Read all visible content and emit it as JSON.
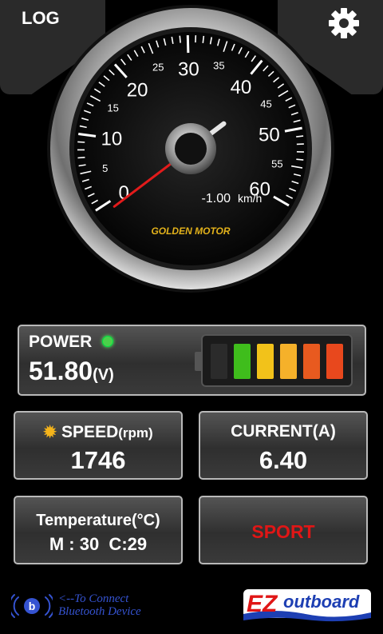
{
  "header": {
    "log_label": "LOG",
    "settings_icon": "gear-icon"
  },
  "gauge": {
    "major_labels": [
      "0",
      "10",
      "20",
      "30",
      "40",
      "50",
      "60"
    ],
    "minor_labels": [
      "5",
      "15",
      "25",
      "35",
      "45",
      "55"
    ],
    "brand": "GOLDEN MOTOR",
    "speed_value": "-1.00",
    "speed_unit": "km/h",
    "needle_value": -1.0,
    "range": [
      0,
      60
    ]
  },
  "power": {
    "label": "POWER",
    "value": "51.80",
    "unit": "(V)",
    "status_color": "#4ad14a",
    "battery_cells": [
      "#2b2b2b",
      "#3fbd1c",
      "#f2c21a",
      "#f5b12a",
      "#e85a1f",
      "#e8481d"
    ]
  },
  "speed": {
    "label": "SPEED",
    "unit": "(rpm)",
    "value": "1746",
    "icon": "sun-icon"
  },
  "current": {
    "label": "CURRENT(A)",
    "value": "6.40"
  },
  "temperature": {
    "label": "Temperature(°C)",
    "value": "M : 30  C:29"
  },
  "mode": {
    "label": "SPORT",
    "color": "#e01616"
  },
  "bluetooth": {
    "icon": "bluetooth-icon",
    "hint_line1": "<--To Connect",
    "hint_line2": "Bluetooth Device"
  },
  "brand": {
    "logo_prefix": "EZ",
    "logo_text": "outboard"
  }
}
